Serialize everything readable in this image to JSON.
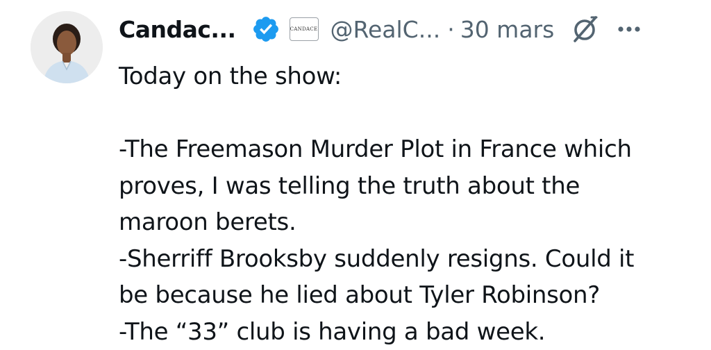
{
  "author": {
    "display_name": "Candac...",
    "handle": "@RealC...",
    "affiliate_badge_text": "CANDACE",
    "verified_badge_color": "#1d9bf0"
  },
  "meta": {
    "separator": "·",
    "date": "30 mars"
  },
  "icons": {
    "verified": "verified-badge-icon",
    "grok": "grok-icon",
    "more": "more-options-icon"
  },
  "tweet": {
    "lines": [
      "Today on the show:",
      "",
      "-The Freemason Murder Plot in France which",
      "proves, I was telling the truth about the",
      "maroon berets.",
      "-Sherriff Brooksby suddenly resigns. Could it",
      "be because he lied about Tyler Robinson?",
      "-The “33” club is having a bad week."
    ]
  }
}
